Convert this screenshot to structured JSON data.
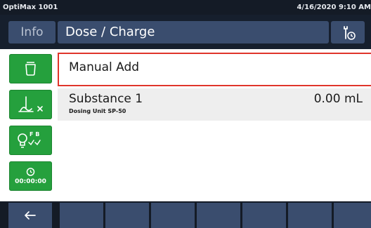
{
  "status_bar": {
    "device_name": "OptiMax 1001",
    "datetime": "4/16/2020 9:10 AM"
  },
  "header": {
    "info_label": "Info",
    "title": "Dose / Charge",
    "tools_icon": "wrench-clock-icon"
  },
  "side_buttons": [
    {
      "icon": "container-icon"
    },
    {
      "icon": "stirrer-off-icon"
    },
    {
      "icon": "lightbulb-fb-check-icon",
      "text": "F B"
    },
    {
      "icon": "clock-icon",
      "text": "00:00:00"
    }
  ],
  "list": {
    "manual_add": {
      "label": "Manual Add"
    },
    "substance": {
      "name": "Substance 1",
      "unit": "Dosing Unit SP-50",
      "amount": "0.00 mL"
    }
  },
  "bottom_bar": {
    "back_icon": "arrow-left-icon",
    "button_count": 8
  },
  "colors": {
    "header_bg": "#161f2d",
    "button_bg": "#3a4d6e",
    "accent_green": "#25a03d",
    "selection_red": "#e0352b",
    "row_bg": "#eeeeee"
  }
}
